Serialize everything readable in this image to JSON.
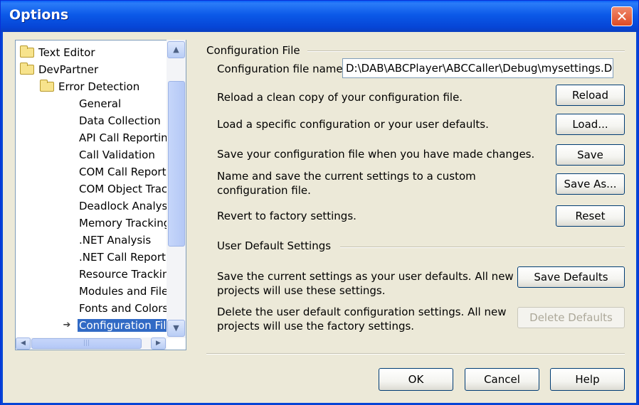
{
  "window": {
    "title": "Options",
    "close_glyph": "✕"
  },
  "tree": {
    "items": [
      {
        "label": "Text Editor",
        "icon": "folder-icon"
      },
      {
        "label": "DevPartner",
        "icon": "open-folder-icon"
      },
      {
        "label": "Error Detection",
        "icon": "open-folder-icon"
      },
      {
        "label": "General"
      },
      {
        "label": "Data Collection"
      },
      {
        "label": "API Call Reportin"
      },
      {
        "label": "Call Validation"
      },
      {
        "label": "COM Call Reportii"
      },
      {
        "label": "COM Object Trac"
      },
      {
        "label": "Deadlock Analysis"
      },
      {
        "label": "Memory Tracking"
      },
      {
        "label": ".NET Analysis"
      },
      {
        "label": ".NET Call Reportii"
      },
      {
        "label": "Resource Trackin"
      },
      {
        "label": "Modules and Files"
      },
      {
        "label": "Fonts and Colors"
      },
      {
        "label": "Configuration File",
        "selected": true
      }
    ],
    "scroll_up": "▲",
    "scroll_down": "▼",
    "scroll_left": "◀",
    "scroll_right": "▶",
    "grip": "|||"
  },
  "config_group": {
    "title": "Configuration File",
    "file_name_label": "Configuration file name",
    "file_name_value": "D:\\DAB\\ABCPlayer\\ABCCaller\\Debug\\mysettings.DPl",
    "reload_desc": "Reload a clean copy of your configuration file.",
    "reload_label": "Reload",
    "load_desc": "Load a specific configuration or your user defaults.",
    "load_label": "Load...",
    "save_desc": "Save your configuration file when you have made changes.",
    "save_label": "Save",
    "save_as_desc_1": "Name and save the current settings to a custom",
    "save_as_desc_2": "configuration file.",
    "save_as_label": "Save As...",
    "reset_desc": "Revert to factory settings.",
    "reset_label": "Reset"
  },
  "user_defaults_group": {
    "title": "User Default Settings",
    "save_defaults_desc_1": "Save the current settings as your user defaults.  All new",
    "save_defaults_desc_2": "projects will use these settings.",
    "save_defaults_label": "Save Defaults",
    "delete_defaults_desc_1": "Delete the user default configuration settings.  All new",
    "delete_defaults_desc_2": "projects will use the factory settings.",
    "delete_defaults_label": "Delete Defaults"
  },
  "footer": {
    "ok_label": "OK",
    "cancel_label": "Cancel",
    "help_label": "Help"
  }
}
